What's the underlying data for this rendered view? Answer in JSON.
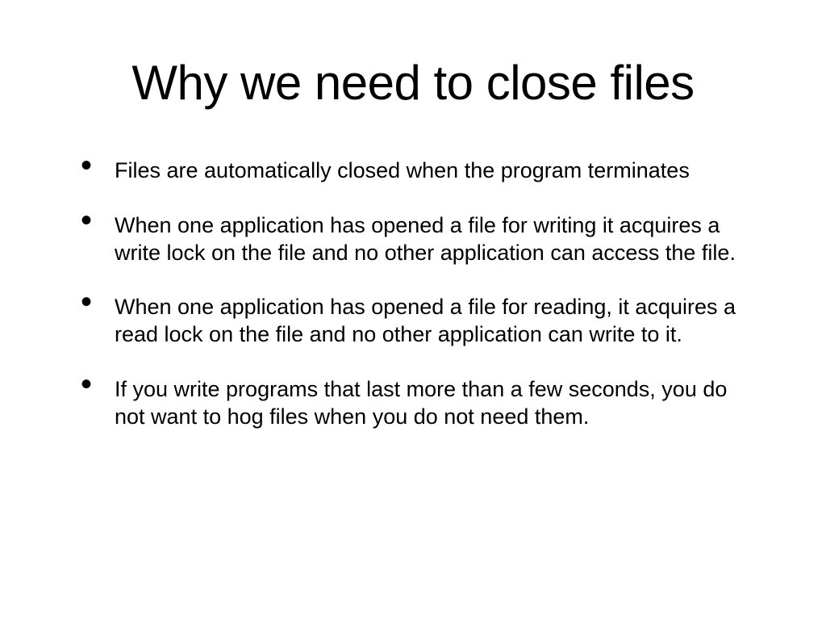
{
  "title": "Why we need to close files",
  "bullets": [
    "Files are automatically closed when the program terminates",
    "When one application has opened a file for writing it acquires a write lock on the file and no other application can access the file.",
    "When one application has opened a file for reading, it acquires a read lock on the file and no other application can write to it.",
    "If you write programs that last more than a few seconds, you do not want to hog files when you do not need them."
  ]
}
